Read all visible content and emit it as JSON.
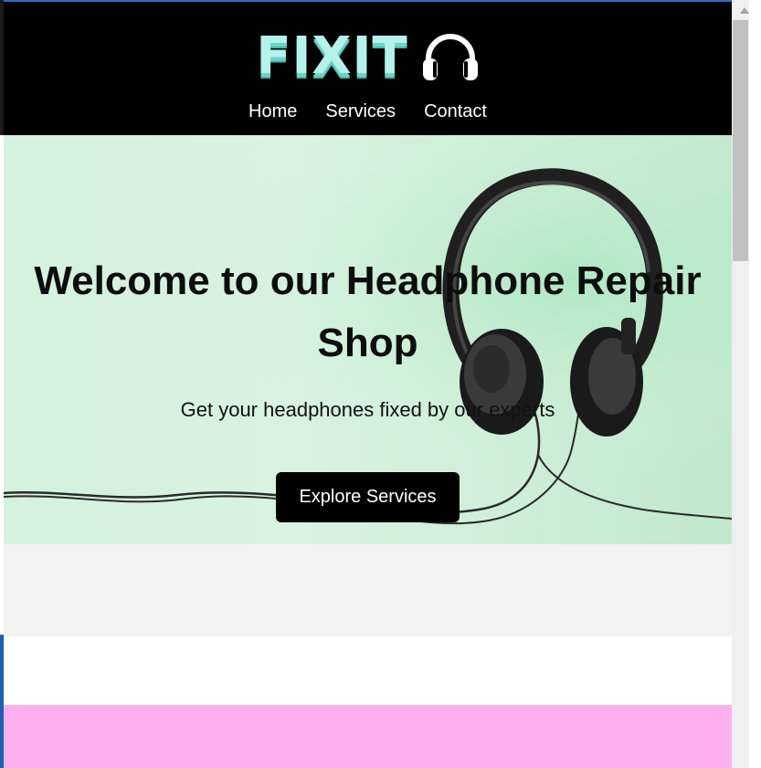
{
  "header": {
    "logo_text": "FIXIT",
    "logo_icon": "headphones-icon",
    "nav": [
      {
        "label": "Home"
      },
      {
        "label": "Services"
      },
      {
        "label": "Contact"
      }
    ]
  },
  "hero": {
    "title": "Welcome to our Headphone Repair Shop",
    "subtitle": "Get your headphones fixed by our experts",
    "cta_label": "Explore Services",
    "image": "headphones-photo"
  },
  "colors": {
    "header_bg": "#000000",
    "logo": "#b6f2ec",
    "hero_bg": "#d4f2dd",
    "section_grey": "#f3f3f3",
    "section_pink": "#fdaff0",
    "button_bg": "#000000"
  }
}
